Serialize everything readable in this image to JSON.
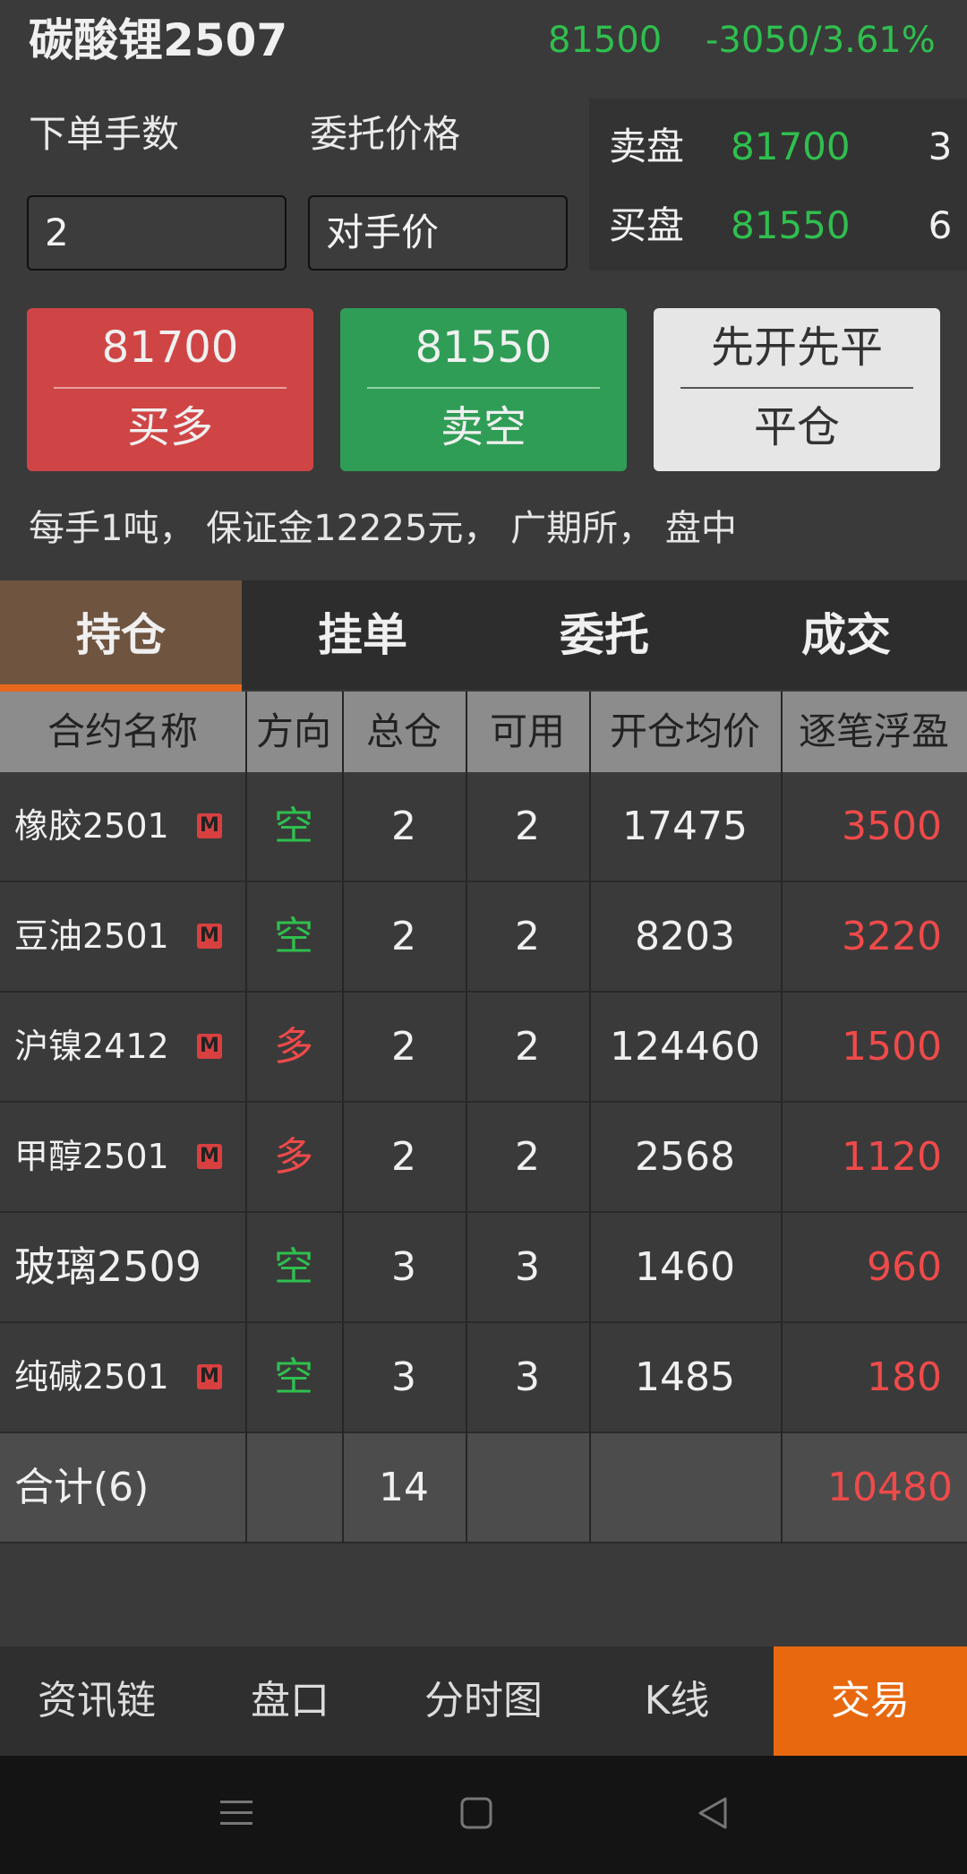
{
  "header": {
    "title": "碳酸锂2507",
    "price": "81500",
    "change": "-3050/3.61%"
  },
  "order": {
    "qty_label": "下单手数",
    "qty_value": "2",
    "price_label": "委托价格",
    "price_value": "对手价"
  },
  "book": {
    "sell_label": "卖盘",
    "sell_price": "81700",
    "sell_qty": "3",
    "buy_label": "买盘",
    "buy_price": "81550",
    "buy_qty": "6"
  },
  "actions": {
    "buy_price": "81700",
    "buy_label": "买多",
    "sell_price": "81550",
    "sell_label": "卖空",
    "close_mode": "先开先平",
    "close_label": "平仓"
  },
  "info_text": "每手1吨， 保证金12225元， 广期所， 盘中",
  "tabs": [
    "持仓",
    "挂单",
    "委托",
    "成交"
  ],
  "table": {
    "headers": [
      "合约名称",
      "方向",
      "总仓",
      "可用",
      "开仓均价",
      "逐笔浮盈"
    ],
    "rows": [
      {
        "name": "橡胶2501",
        "badge": "M",
        "dir": "空",
        "total": "2",
        "avail": "2",
        "avg": "17475",
        "pnl": "3500"
      },
      {
        "name": "豆油2501",
        "badge": "M",
        "dir": "空",
        "total": "2",
        "avail": "2",
        "avg": "8203",
        "pnl": "3220"
      },
      {
        "name": "沪镍2412",
        "badge": "M",
        "dir": "多",
        "total": "2",
        "avail": "2",
        "avg": "124460",
        "pnl": "1500"
      },
      {
        "name": "甲醇2501",
        "badge": "M",
        "dir": "多",
        "total": "2",
        "avail": "2",
        "avg": "2568",
        "pnl": "1120"
      },
      {
        "name": "玻璃2509",
        "badge": "",
        "dir": "空",
        "total": "3",
        "avail": "3",
        "avg": "1460",
        "pnl": "960"
      },
      {
        "name": "纯碱2501",
        "badge": "M",
        "dir": "空",
        "total": "3",
        "avail": "3",
        "avg": "1485",
        "pnl": "180"
      }
    ],
    "summary": {
      "label": "合计(6)",
      "total": "14",
      "pnl": "10480"
    }
  },
  "nav": [
    "资讯链",
    "盘口",
    "分时图",
    "K线",
    "交易"
  ],
  "colors": {
    "up": "#ef4a4a",
    "down": "#2fbf4e",
    "accent": "#e8680f"
  }
}
